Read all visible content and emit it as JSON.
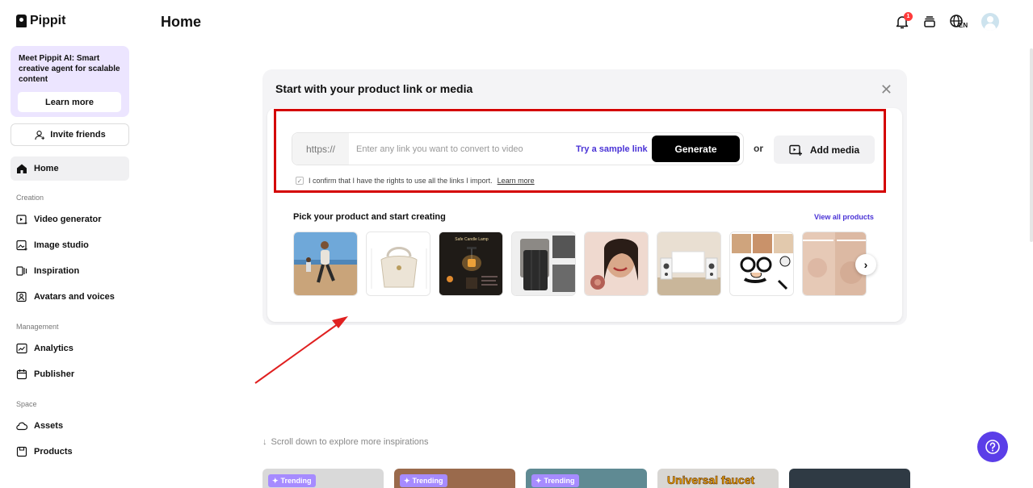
{
  "app": {
    "name": "Pippit"
  },
  "sidebar": {
    "promo": {
      "text": "Meet Pippit AI: Smart creative agent for scalable content",
      "button": "Learn more"
    },
    "invite": "Invite friends",
    "home": "Home",
    "sections": [
      {
        "title": "Creation",
        "items": [
          "Video generator",
          "Image studio",
          "Inspiration",
          "Avatars and voices"
        ]
      },
      {
        "title": "Management",
        "items": [
          "Analytics",
          "Publisher"
        ]
      },
      {
        "title": "Space",
        "items": [
          "Assets",
          "Products"
        ]
      }
    ]
  },
  "header": {
    "title": "Home",
    "notification_count": "1",
    "language": "EN"
  },
  "card": {
    "title": "Start with your product link or media",
    "link_prefix": "https://",
    "link_placeholder": "Enter any link you want to convert to video",
    "sample_link": "Try a sample link",
    "generate": "Generate",
    "or": "or",
    "add_media": "Add media",
    "confirm_text": "I confirm that I have the rights to use all the links I import.",
    "confirm_link": "Learn more",
    "pick_title": "Pick your product and start creating",
    "view_all": "View all products",
    "thumb_texts": {
      "candle": "Safe Candle Lamp"
    }
  },
  "scroll_hint": "Scroll down to explore more inspirations",
  "trending": [
    "Trending",
    "Trending",
    "Trending"
  ],
  "trend_caption": "Universal faucet",
  "colors": {
    "accent": "#4a33d6",
    "help": "#5b3ee8",
    "highlight": "#d40000"
  }
}
